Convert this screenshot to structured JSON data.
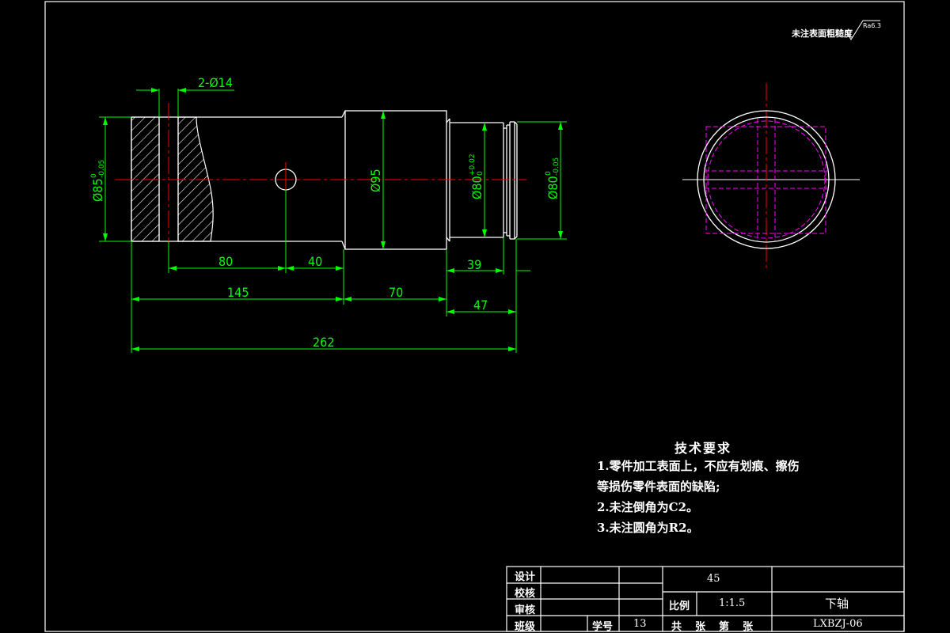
{
  "roughness": {
    "label": "未注表面粗糙度",
    "value": "Ra6.3"
  },
  "dimensions": {
    "holes": "2-Ø14",
    "d_left": "Ø85",
    "d_left_tol": "-0.05",
    "d_left_tol_upper": "0",
    "d_mid": "Ø95",
    "d_right1": "Ø80",
    "d_right1_tol_upper": "+0.02",
    "d_right1_tol_lower": "0",
    "d_right2": "Ø80",
    "d_right2_tol_upper": "0",
    "d_right2_tol_lower": "-0.05",
    "len_80": "80",
    "len_40": "40",
    "len_145": "145",
    "len_70": "70",
    "len_39": "39",
    "len_47": "47",
    "len_262": "262"
  },
  "tech_requirements": {
    "title": "技术要求",
    "lines": [
      "1.零件加工表面上，不应有划痕、擦伤",
      "等损伤零件表面的缺陷;",
      "2.未注倒角为C2。",
      "3.未注圆角为R2。"
    ]
  },
  "title_block": {
    "design": "设计",
    "check": "校核",
    "review": "审核",
    "class": "班级",
    "student_no_label": "学号",
    "student_no": "13",
    "material": "45",
    "scale_label": "比例",
    "scale": "1:1.5",
    "sheets": "共　张　第　张",
    "part_name": "下轴",
    "drawing_no": "LXBZJ-06"
  },
  "colors": {
    "background": "#000000",
    "outline": "#ffffff",
    "dimension": "#00ff00",
    "centerline": "#ff0000",
    "hidden": "#ff00ff"
  }
}
